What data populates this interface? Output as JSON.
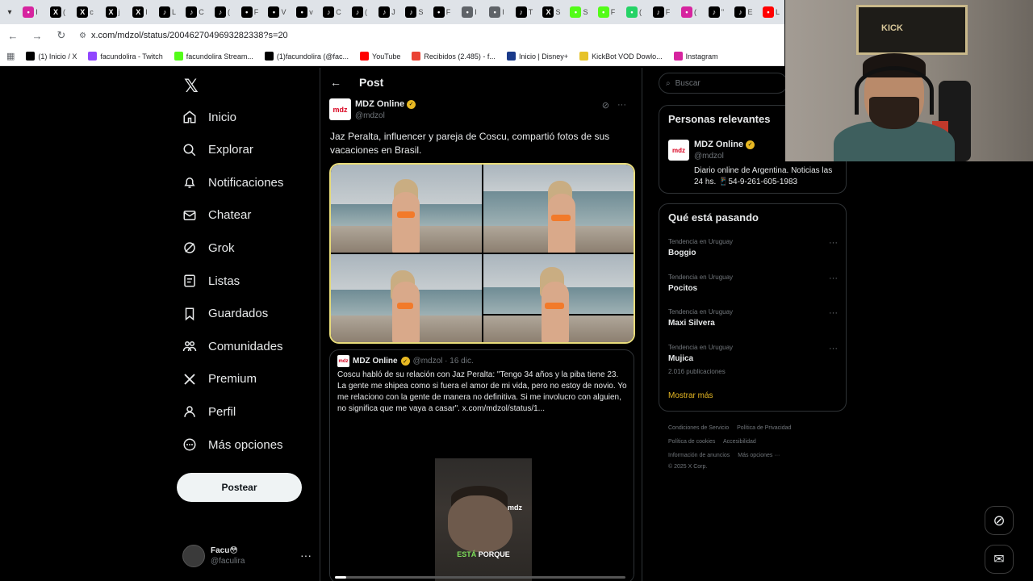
{
  "browser": {
    "tabs": [
      {
        "icon": "instagram-icon",
        "label": "I",
        "color": "#d6249f"
      },
      {
        "icon": "x-icon",
        "label": "(",
        "color": "#000000"
      },
      {
        "icon": "x-icon",
        "label": "c",
        "color": "#000000"
      },
      {
        "icon": "x-icon",
        "label": "j",
        "color": "#000000"
      },
      {
        "icon": "x-icon",
        "label": "I",
        "color": "#000000"
      },
      {
        "icon": "tiktok-icon",
        "label": "L",
        "color": "#000000"
      },
      {
        "icon": "tiktok-icon",
        "label": "C",
        "color": "#000000"
      },
      {
        "icon": "tiktok-icon",
        "label": "(",
        "color": "#000000"
      },
      {
        "icon": "flag-icon",
        "label": "F",
        "color": "#000000"
      },
      {
        "icon": "v-icon",
        "label": "V",
        "color": "#000000"
      },
      {
        "icon": "v-icon",
        "label": "v",
        "color": "#000000"
      },
      {
        "icon": "tiktok-icon",
        "label": "C",
        "color": "#000000"
      },
      {
        "icon": "tiktok-icon",
        "label": "(",
        "color": "#000000"
      },
      {
        "icon": "tiktok-icon",
        "label": "J",
        "color": "#000000"
      },
      {
        "icon": "tiktok-icon",
        "label": "S",
        "color": "#000000"
      },
      {
        "icon": "flag-icon",
        "label": "F",
        "color": "#000000"
      },
      {
        "icon": "globe-icon",
        "label": "I",
        "color": "#5f6368"
      },
      {
        "icon": "globe-icon",
        "label": "I",
        "color": "#5f6368"
      },
      {
        "icon": "tiktok-icon",
        "label": "T",
        "color": "#000000"
      },
      {
        "icon": "x-icon",
        "label": "S",
        "color": "#000000"
      },
      {
        "icon": "kick-icon",
        "label": "S",
        "color": "#53fc18"
      },
      {
        "icon": "kick-icon",
        "label": "F",
        "color": "#53fc18"
      },
      {
        "icon": "whatsapp-icon",
        "label": "(",
        "color": "#25d366"
      },
      {
        "icon": "tiktok-icon",
        "label": "F",
        "color": "#000000"
      },
      {
        "icon": "instagram-icon",
        "label": "(",
        "color": "#d6249f"
      },
      {
        "icon": "tiktok-icon",
        "label": "\"",
        "color": "#000000"
      },
      {
        "icon": "tiktok-icon",
        "label": "E",
        "color": "#000000"
      },
      {
        "icon": "youtube-icon",
        "label": "L",
        "color": "#ff0000"
      }
    ],
    "url": "x.com/mdzol/status/2004627049693282338?s=20",
    "bookmarks": [
      {
        "icon": "x-icon",
        "label": "(1) Inicio / X",
        "color": "#000000"
      },
      {
        "icon": "twitch-icon",
        "label": "facundolira - Twitch",
        "color": "#9146ff"
      },
      {
        "icon": "kick-icon",
        "label": "facundolira Stream...",
        "color": "#53fc18"
      },
      {
        "icon": "tiktok-icon",
        "label": "(1)facundolira (@fac...",
        "color": "#000000"
      },
      {
        "icon": "youtube-icon",
        "label": "YouTube",
        "color": "#ff0000"
      },
      {
        "icon": "gmail-icon",
        "label": "Recibidos (2.485) - f...",
        "color": "#ea4335"
      },
      {
        "icon": "disney-icon",
        "label": "Inicio | Disney+",
        "color": "#1a3a8a"
      },
      {
        "icon": "kickbot-icon",
        "label": "KickBot VOD Dowlo...",
        "color": "#e6c229"
      },
      {
        "icon": "instagram-icon",
        "label": "Instagram",
        "color": "#d6249f"
      }
    ]
  },
  "nav": {
    "items": [
      {
        "label": "Inicio",
        "icon": "home-icon"
      },
      {
        "label": "Explorar",
        "icon": "search-icon"
      },
      {
        "label": "Notificaciones",
        "icon": "bell-icon"
      },
      {
        "label": "Chatear",
        "icon": "mail-icon"
      },
      {
        "label": "Grok",
        "icon": "grok-icon"
      },
      {
        "label": "Listas",
        "icon": "list-icon"
      },
      {
        "label": "Guardados",
        "icon": "bookmark-icon"
      },
      {
        "label": "Comunidades",
        "icon": "communities-icon"
      },
      {
        "label": "Premium",
        "icon": "x-logo-icon"
      },
      {
        "label": "Perfil",
        "icon": "person-icon"
      },
      {
        "label": "Más opciones",
        "icon": "more-circle-icon"
      }
    ],
    "post_button": "Postear",
    "user": {
      "name": "Facu😳",
      "handle": "@faculira"
    }
  },
  "post": {
    "header": "Post",
    "author_name": "MDZ Online",
    "author_handle": "@mdzol",
    "logo_text": "mdz",
    "text": "Jaz Peralta, influencer y pareja de Coscu, compartió fotos de sus vacaciones en Brasil.",
    "quote": {
      "author_name": "MDZ Online",
      "meta": "@mdzol · 16 dic.",
      "text": "Coscu habló de su relación con Jaz Peralta: \"Tengo 34 años y la piba tiene 23. La gente me shipea como si fuera el amor de mi vida, pero no estoy de novio. Yo me relaciono con la gente de manera no definitiva. Si me involucro con alguien, no significa que me vaya a casar\".  x.com/mdzol/status/1...",
      "video_logo": "mdz",
      "caption_green": "ESTÁ",
      "caption_white": "PORQUE",
      "progress": 0.04
    }
  },
  "right": {
    "search_placeholder": "Buscar",
    "relevant": {
      "title": "Personas relevantes",
      "name": "MDZ Online",
      "handle": "@mdzol",
      "bio": "Diario online de Argentina. Noticias las 24 hs. 📱54-9-261-605-1983",
      "logo_text": "mdz"
    },
    "trending": {
      "title": "Qué está pasando",
      "items": [
        {
          "context": "Tendencia en Uruguay",
          "name": "Boggio",
          "count": ""
        },
        {
          "context": "Tendencia en Uruguay",
          "name": "Pocitos",
          "count": ""
        },
        {
          "context": "Tendencia en Uruguay",
          "name": "Maxi Silvera",
          "count": ""
        },
        {
          "context": "Tendencia en Uruguay",
          "name": "Mujica",
          "count": "2.016 publicaciones"
        }
      ],
      "show_more": "Mostrar más"
    },
    "footer": {
      "links": [
        "Condiciones de Servicio",
        "Política de Privacidad",
        "Política de cookies",
        "Accesibilidad",
        "Información de anuncios",
        "Más opciones ···"
      ],
      "copyright": "© 2025 X Corp."
    }
  },
  "colors": {
    "accent": "#e8b923",
    "highlight_border": "#e8dc7b",
    "background": "#000000"
  }
}
